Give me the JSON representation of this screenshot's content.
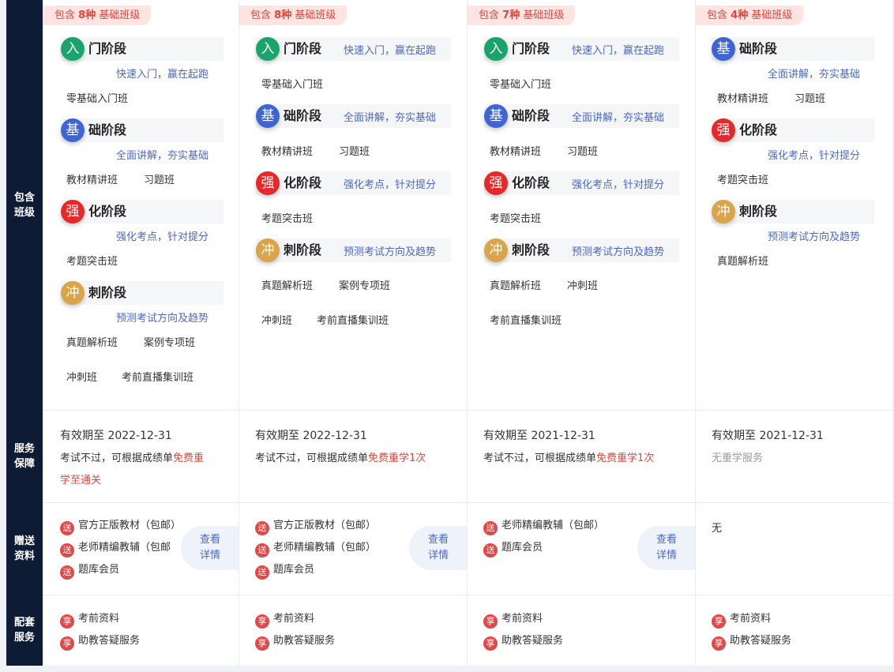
{
  "row_labels": [
    "包含班级",
    "服务保障",
    "赠送资料",
    "配套服务"
  ],
  "columns": [
    {
      "badge": {
        "prefix": "包含",
        "count": "8种",
        "suffix": "基础班级"
      },
      "stages": [
        {
          "icon": "入",
          "title": "门阶段",
          "desc": "快速入门，赢在起跑",
          "classes": [
            "零基础入门班"
          ]
        },
        {
          "icon": "基",
          "title": "础阶段",
          "desc": "全面讲解，夯实基础",
          "classes": [
            "教材精讲班",
            "习题班"
          ]
        },
        {
          "icon": "强",
          "title": "化阶段",
          "desc": "强化考点，针对提分",
          "classes": [
            "考题突击班"
          ]
        },
        {
          "icon": "冲",
          "title": "刺阶段",
          "desc": "预测考试方向及趋势",
          "classes": [
            "真题解析班",
            "案例专项班",
            "冲刺班",
            "考前直播集训班"
          ]
        }
      ],
      "service": {
        "validity": "有效期至 2022-12-31",
        "note_prefix": "考试不过，可根据成绩单",
        "note_line1_red": "免费重",
        "note_line2_red": "学至通关"
      },
      "gifts": [
        "官方正版教材（包邮）",
        "老师精编教辅（包邮",
        "题库会员"
      ],
      "detail": [
        "查看",
        "详情"
      ],
      "support": [
        "考前资料",
        "助教答疑服务"
      ]
    },
    {
      "badge": {
        "prefix": "包含",
        "count": "8种",
        "suffix": "基础班级"
      },
      "stages": [
        {
          "icon": "入",
          "title": "门阶段",
          "desc": "快速入门，赢在起跑",
          "classes": [
            "零基础入门班"
          ]
        },
        {
          "icon": "基",
          "title": "础阶段",
          "desc": "全面讲解，夯实基础",
          "classes": [
            "教材精讲班",
            "习题班"
          ]
        },
        {
          "icon": "强",
          "title": "化阶段",
          "desc": "强化考点，针对提分",
          "classes": [
            "考题突击班"
          ]
        },
        {
          "icon": "冲",
          "title": "刺阶段",
          "desc": "预测考试方向及趋势",
          "classes": [
            "真题解析班",
            "案例专项班",
            "冲刺班",
            "考前直播集训班"
          ]
        }
      ],
      "service": {
        "validity": "有效期至 2022-12-31",
        "note_prefix": "考试不过，可根据成绩单",
        "note_red": "免费重学1次"
      },
      "gifts": [
        "官方正版教材（包邮）",
        "老师精编教辅（包邮）",
        "题库会员"
      ],
      "detail": [
        "查看",
        "详情"
      ],
      "support": [
        "考前资料",
        "助教答疑服务"
      ]
    },
    {
      "badge": {
        "prefix": "包含",
        "count": "7种",
        "suffix": "基础班级"
      },
      "stages": [
        {
          "icon": "入",
          "title": "门阶段",
          "desc": "快速入门，赢在起跑",
          "classes": [
            "零基础入门班"
          ]
        },
        {
          "icon": "基",
          "title": "础阶段",
          "desc": "全面讲解，夯实基础",
          "classes": [
            "教材精讲班",
            "习题班"
          ]
        },
        {
          "icon": "强",
          "title": "化阶段",
          "desc": "强化考点，针对提分",
          "classes": [
            "考题突击班"
          ]
        },
        {
          "icon": "冲",
          "title": "刺阶段",
          "desc": "预测考试方向及趋势",
          "classes": [
            "真题解析班",
            "冲刺班",
            "考前直播集训班"
          ]
        }
      ],
      "service": {
        "validity": "有效期至 2021-12-31",
        "note_prefix": "考试不过，可根据成绩单",
        "note_red": "免费重学1次"
      },
      "gifts": [
        "老师精编教辅（包邮）",
        "题库会员"
      ],
      "detail": [
        "查看",
        "详情"
      ],
      "support": [
        "考前资料",
        "助教答疑服务"
      ]
    },
    {
      "badge": {
        "prefix": "包含",
        "count": "4种",
        "suffix": "基础班级"
      },
      "stages": [
        {
          "icon": "基",
          "title": "础阶段",
          "desc": "全面讲解，夯实基础",
          "classes": [
            "教材精讲班",
            "习题班"
          ]
        },
        {
          "icon": "强",
          "title": "化阶段",
          "desc": "强化考点，针对提分",
          "classes": [
            "考题突击班"
          ]
        },
        {
          "icon": "冲",
          "title": "刺阶段",
          "desc": "预测考试方向及趋势",
          "classes": [
            "真题解析班"
          ]
        }
      ],
      "service": {
        "validity": "有效期至 2021-12-31",
        "note_gray": "无重学服务"
      },
      "gifts_none": "无",
      "support": [
        "考前资料",
        "助教答疑服务"
      ]
    }
  ],
  "tag_chars": {
    "gift": "送",
    "support": "享"
  },
  "colors": {
    "sidebar": "#0d1b34",
    "icon_入": "#1aa36a",
    "icon_基": "#3f64d6",
    "icon_强": "#e5282a",
    "icon_冲": "#d9a44a",
    "accent_red": "#e0473c",
    "accent_blue": "#4b68c3"
  }
}
